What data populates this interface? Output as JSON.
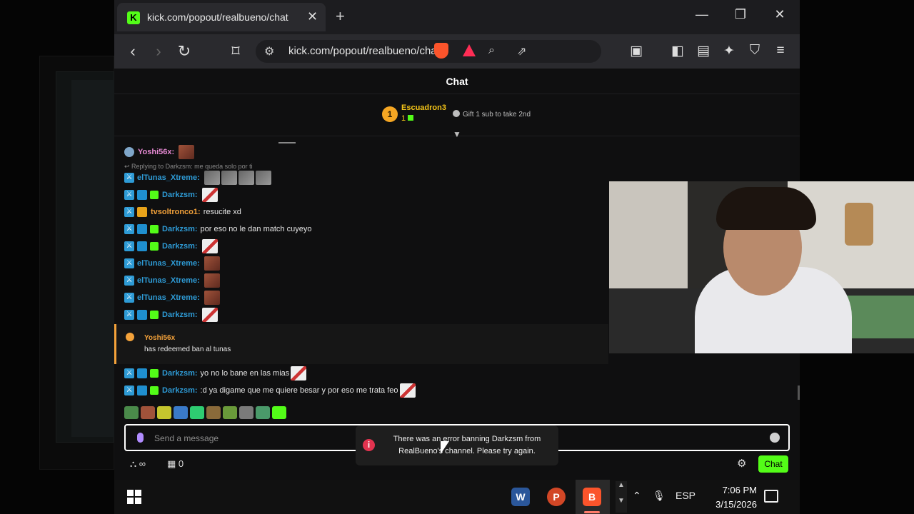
{
  "browser": {
    "tab_title": "kick.com/popout/realbueno/chat",
    "tab_favicon": "K",
    "url": "kick.com/popout/realbueno/chat",
    "shield_count": "4"
  },
  "chat": {
    "title": "Chat",
    "pinned": {
      "rank": "1",
      "name": "Escuadron3",
      "count": "1",
      "gift_text": "Gift 1 sub to take 2nd"
    },
    "first_message": {
      "user": "Yoshi56x:"
    },
    "reply_text": "Replying to Darkzsm: me queda solo por ti",
    "messages": [
      {
        "user": "elTunas_Xtreme:",
        "color": "#2e9bd6",
        "text": ""
      },
      {
        "user": "Darkzsm:",
        "color": "#2e9bd6",
        "text": ""
      },
      {
        "user": "tvsoltronco1:",
        "color": "#f4a23a",
        "text": "resucite xd"
      },
      {
        "user": "Darkzsm:",
        "color": "#2e9bd6",
        "text": "por eso no le dan match cuyeyo"
      },
      {
        "user": "Darkzsm:",
        "color": "#2e9bd6",
        "text": ""
      },
      {
        "user": "elTunas_Xtreme:",
        "color": "#2e9bd6",
        "text": ""
      },
      {
        "user": "elTunas_Xtreme:",
        "color": "#2e9bd6",
        "text": ""
      },
      {
        "user": "elTunas_Xtreme:",
        "color": "#2e9bd6",
        "text": ""
      },
      {
        "user": "Darkzsm:",
        "color": "#2e9bd6",
        "text": ""
      }
    ],
    "redeem": {
      "user": "Yoshi56x",
      "text": "has redeemed ban al tunas"
    },
    "messages_after": [
      {
        "user": "Darkzsm:",
        "color": "#2e9bd6",
        "text": "yo no lo bane en las mias"
      },
      {
        "user": "Darkzsm:",
        "color": "#2e9bd6",
        "text": ":d ya digame que me quiere besar y por eso me trata feo"
      }
    ],
    "input_placeholder": "Send a message",
    "footer_left": "∞",
    "footer_store": "0",
    "send_label": "Chat",
    "toast": "There was an error banning Darkzsm from RealBueno's channel. Please try again."
  },
  "taskbar": {
    "lang": "ESP",
    "time": "7:06 PM",
    "date": "3/15/2026"
  },
  "colors": {
    "kick_green": "#53fc18",
    "mod_blue": "#2e9bd6",
    "accent_orange": "#f4a23a",
    "error_red": "#e2334f"
  }
}
